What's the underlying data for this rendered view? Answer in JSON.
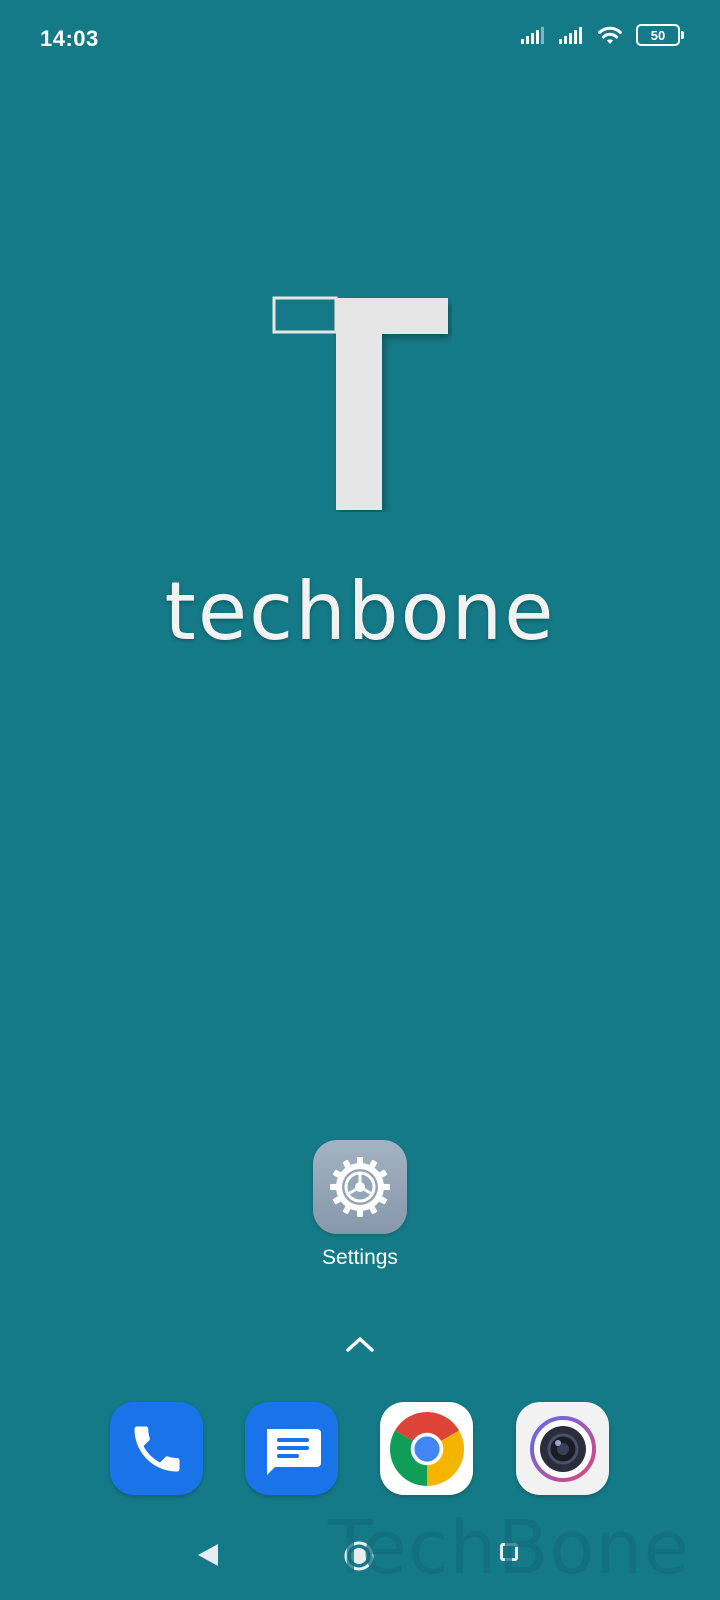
{
  "status_bar": {
    "time": "14:03",
    "battery_level": "50",
    "signal_icons": [
      "signal-1-icon",
      "signal-2-icon"
    ],
    "wifi_icon": "wifi-icon"
  },
  "wallpaper": {
    "background_color": "#157a87",
    "logo_text": "techbone"
  },
  "home_apps": [
    {
      "label": "Settings",
      "icon": "gear-icon"
    }
  ],
  "app_drawer": {
    "icon": "chevron-up-icon"
  },
  "dock": [
    {
      "icon": "phone-icon",
      "color": "#1a73e8"
    },
    {
      "icon": "messages-icon",
      "color": "#1a73e8"
    },
    {
      "icon": "chrome-icon",
      "color": "#ffffff"
    },
    {
      "icon": "camera-icon",
      "color": "#f2f2f2"
    }
  ],
  "navigation": {
    "back_icon": "back-triangle-icon",
    "home_icon": "home-circle-icon",
    "recents_icon": "recents-square-icon"
  },
  "watermark_text": "TechBone"
}
